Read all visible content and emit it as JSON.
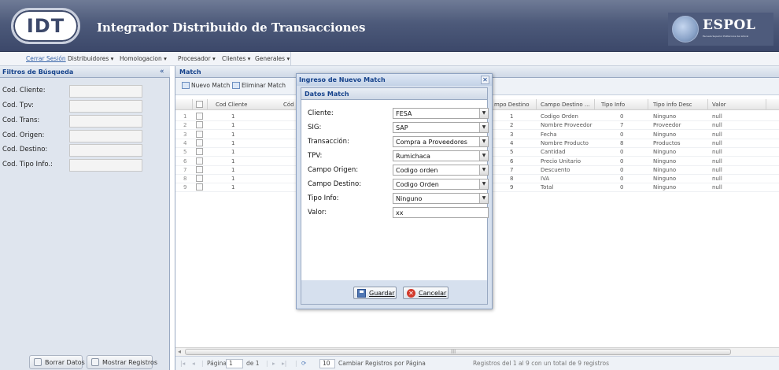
{
  "header": {
    "logo_text": "IDT",
    "title": "Integrador Distribuido de Transacciones",
    "brand_name": "ESPOL",
    "brand_subtitle": "Escuela Superior Politécnica del Litoral"
  },
  "menu": {
    "logout": "Cerrar Sesión",
    "items": [
      "Distribuidores ▾",
      "Homologacion ▾",
      "Procesador ▾",
      "Clientes ▾",
      "Generales ▾"
    ]
  },
  "filters": {
    "title": "Filtros de Búsqueda",
    "collapse_glyph": "«",
    "fields": [
      "Cod. Cliente:",
      "Cod. Tpv:",
      "Cod. Trans:",
      "Cod. Origen:",
      "Cod. Destino:",
      "Cod. Tipo Info.:"
    ],
    "clear_button": "Borrar Datos",
    "show_button": "Mostrar Registros"
  },
  "grid": {
    "title": "Match",
    "new_button": "Nuevo Match",
    "delete_button": "Eliminar Match",
    "columns": {
      "cod_cliente": "Cod Cliente",
      "cod_truncated": "Cód",
      "campo_destino_cod": "mpo Destino",
      "campo_destino_desc": "Campo Destino ...",
      "tipo_info": "Tipo Info",
      "tipo_info_desc": "Tipo info Desc",
      "valor": "Valor"
    },
    "rows": [
      {
        "n": "1",
        "cliente": "1",
        "dest": "1",
        "dest_desc": "Codigo Orden",
        "tipo": "0",
        "tipo_desc": "Ninguno",
        "valor": "null"
      },
      {
        "n": "2",
        "cliente": "1",
        "dest": "2",
        "dest_desc": "Nombre Proveedor",
        "tipo": "7",
        "tipo_desc": "Proveedor",
        "valor": "null"
      },
      {
        "n": "3",
        "cliente": "1",
        "dest": "3",
        "dest_desc": "Fecha",
        "tipo": "0",
        "tipo_desc": "Ninguno",
        "valor": "null"
      },
      {
        "n": "4",
        "cliente": "1",
        "dest": "4",
        "dest_desc": "Nombre Producto",
        "tipo": "8",
        "tipo_desc": "Productos",
        "valor": "null"
      },
      {
        "n": "5",
        "cliente": "1",
        "dest": "5",
        "dest_desc": "Cantidad",
        "tipo": "0",
        "tipo_desc": "Ninguno",
        "valor": "null"
      },
      {
        "n": "6",
        "cliente": "1",
        "dest": "6",
        "dest_desc": "Precio Unitario",
        "tipo": "0",
        "tipo_desc": "Ninguno",
        "valor": "null"
      },
      {
        "n": "7",
        "cliente": "1",
        "dest": "7",
        "dest_desc": "Descuento",
        "tipo": "0",
        "tipo_desc": "Ninguno",
        "valor": "null"
      },
      {
        "n": "8",
        "cliente": "1",
        "dest": "8",
        "dest_desc": "IVA",
        "tipo": "0",
        "tipo_desc": "Ninguno",
        "valor": "null"
      },
      {
        "n": "9",
        "cliente": "1",
        "dest": "9",
        "dest_desc": "Total",
        "tipo": "0",
        "tipo_desc": "Ninguno",
        "valor": "null"
      }
    ],
    "scroll_grip": "III",
    "pager": {
      "page_label": "Página",
      "page_value": "1",
      "of_label": "de 1",
      "page_size": "10",
      "page_size_label": "Cambiar Registros por Página",
      "summary": "Registros del 1 al 9 con un total de 9 registros"
    }
  },
  "modal": {
    "title": "Ingreso de Nuevo Match",
    "close_glyph": "✕",
    "section_title": "Datos Match",
    "fields": [
      {
        "label": "Cliente:",
        "value": "FESA",
        "type": "select"
      },
      {
        "label": "SIG:",
        "value": "SAP",
        "type": "select"
      },
      {
        "label": "Transacción:",
        "value": "Compra a Proveedores",
        "type": "select"
      },
      {
        "label": "TPV:",
        "value": "Rumichaca",
        "type": "select"
      },
      {
        "label": "Campo Origen:",
        "value": "Codigo orden",
        "type": "select"
      },
      {
        "label": "Campo Destino:",
        "value": "Codigo Orden",
        "type": "select"
      },
      {
        "label": "Tipo Info:",
        "value": "Ninguno",
        "type": "select"
      },
      {
        "label": "Valor:",
        "value": "xx",
        "type": "input"
      }
    ],
    "save_button": "Guardar",
    "cancel_button": "Cancelar",
    "dropdown_glyph": "▼"
  },
  "colors": {
    "header_bg": "#4d5a7a",
    "panel_title": "#15428b",
    "panel_bg": "#dfe5ee"
  }
}
